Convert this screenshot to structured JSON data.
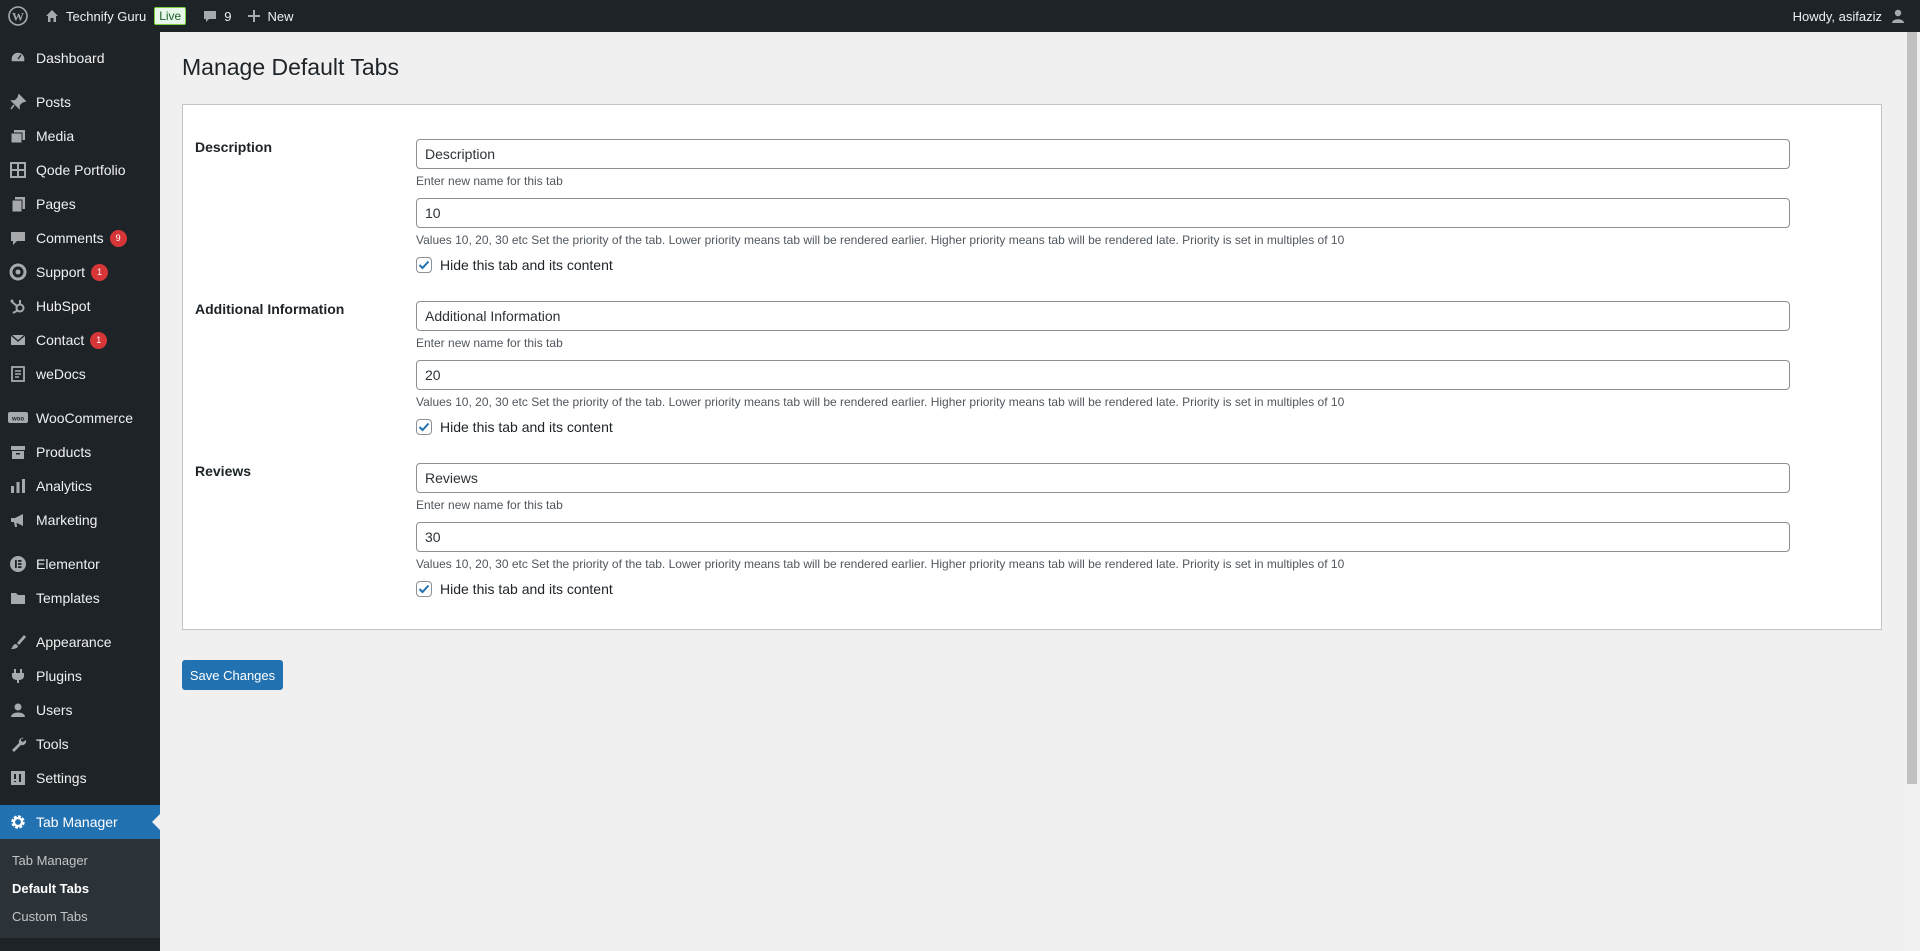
{
  "adminbar": {
    "site_name": "Technify Guru",
    "live_label": "Live",
    "comments_count": "9",
    "new_label": "New",
    "howdy": "Howdy, asifaziz"
  },
  "sidebar": {
    "items": [
      {
        "label": "Dashboard",
        "icon": "dashboard-icon"
      },
      {
        "label": "Posts",
        "icon": "pin-icon"
      },
      {
        "label": "Media",
        "icon": "media-icon"
      },
      {
        "label": "Qode Portfolio",
        "icon": "grid-icon"
      },
      {
        "label": "Pages",
        "icon": "pages-icon"
      },
      {
        "label": "Comments",
        "icon": "comment-icon",
        "count": "9"
      },
      {
        "label": "Support",
        "icon": "support-icon",
        "count": "1"
      },
      {
        "label": "HubSpot",
        "icon": "hubspot-icon"
      },
      {
        "label": "Contact",
        "icon": "mail-icon",
        "count": "1"
      },
      {
        "label": "weDocs",
        "icon": "docs-icon"
      },
      {
        "label": "WooCommerce",
        "icon": "woo-icon"
      },
      {
        "label": "Products",
        "icon": "archive-icon"
      },
      {
        "label": "Analytics",
        "icon": "chart-icon"
      },
      {
        "label": "Marketing",
        "icon": "megaphone-icon"
      },
      {
        "label": "Elementor",
        "icon": "elementor-icon"
      },
      {
        "label": "Templates",
        "icon": "folder-icon"
      },
      {
        "label": "Appearance",
        "icon": "brush-icon"
      },
      {
        "label": "Plugins",
        "icon": "plugin-icon"
      },
      {
        "label": "Users",
        "icon": "user-icon"
      },
      {
        "label": "Tools",
        "icon": "wrench-icon"
      },
      {
        "label": "Settings",
        "icon": "settings-icon"
      },
      {
        "label": "Tab Manager",
        "icon": "gear-icon"
      }
    ],
    "submenu": [
      "Tab Manager",
      "Default Tabs",
      "Custom Tabs"
    ]
  },
  "page": {
    "title": "Manage Default Tabs",
    "name_hint": "Enter new name for this tab",
    "priority_hint": "Values 10, 20, 30 etc Set the priority of the tab. Lower priority means tab will be rendered earlier. Higher priority means tab will be rendered late. Priority is set in multiples of 10",
    "hide_label": "Hide this tab and its content",
    "save_label": "Save Changes",
    "tabs": [
      {
        "label": "Description",
        "name": "Description",
        "priority": "10",
        "hidden": true
      },
      {
        "label": "Additional Information",
        "name": "Additional Information",
        "priority": "20",
        "hidden": true
      },
      {
        "label": "Reviews",
        "name": "Reviews",
        "priority": "30",
        "hidden": true
      }
    ]
  }
}
